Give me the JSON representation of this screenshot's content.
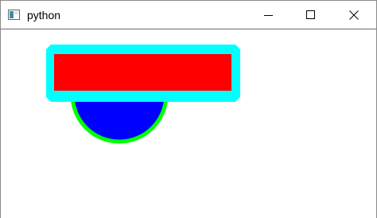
{
  "window": {
    "title": "python",
    "icons": {
      "app": "python-window-icon",
      "minimize": "minimize-icon",
      "maximize": "maximize-icon",
      "close": "close-icon"
    }
  },
  "canvas": {
    "shapes": [
      {
        "name": "blue-semicircle",
        "fill": "#0000ff",
        "outline": "#00ff00"
      },
      {
        "name": "red-rectangle",
        "fill": "#ff0000",
        "outline": "#00ffff"
      }
    ]
  }
}
